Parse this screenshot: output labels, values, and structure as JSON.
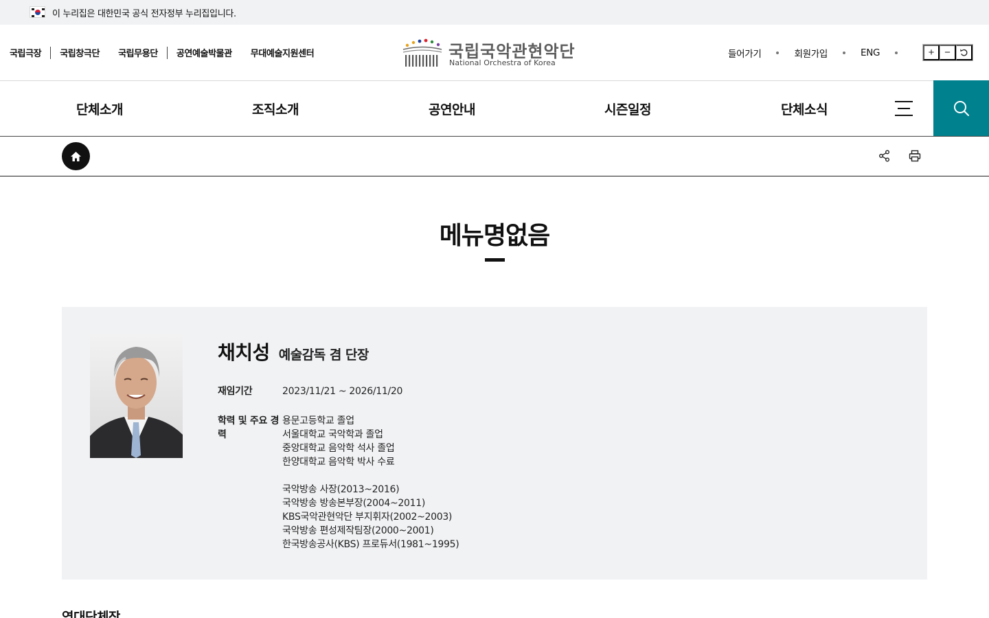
{
  "gov_banner": {
    "text": "이 누리집은 대한민국 공식 전자정부 누리집입니다."
  },
  "header": {
    "family_links": [
      "국립극장",
      "국립창극단",
      "국립무용단",
      "공연예술박물관",
      "무대예술지원센터"
    ],
    "logo": {
      "korean": "국립국악관현악단",
      "english": "National Orchestra of Korea"
    },
    "util_links": [
      "들어가기",
      "회원가입",
      "ENG"
    ],
    "zoom": {
      "in": "+",
      "out": "−",
      "reset": "↺"
    }
  },
  "gnb": {
    "items": [
      "단체소개",
      "조직소개",
      "공연안내",
      "시즌일정",
      "단체소식"
    ],
    "menu_icon": "hamburger-icon",
    "search_icon": "search-icon",
    "accent_color": "#00818e"
  },
  "location_bar": {
    "home_icon": "home-icon",
    "share_icon": "share-icon",
    "print_icon": "print-icon"
  },
  "page": {
    "title": "메뉴명없음"
  },
  "profile": {
    "name": "채치성",
    "position": "예술감독 겸 단장",
    "term_label": "재임기간",
    "term_value": "2023/11/21 ~ 2026/11/20",
    "career_label_line1": "학력 및 주요 경",
    "career_label_line2": "력",
    "career": [
      "용문고등학교 졸업",
      "서울대학교 국악학과 졸업",
      "중앙대학교 음악학 석사 졸업",
      "한양대학교 음악학 박사 수료",
      "",
      "국악방송 사장(2013~2016)",
      "국악방송 방송본부장(2004~2011)",
      "KBS국악관현악단 부지휘자(2002~2003)",
      "국악방송 편성제작팀장(2000~2001)",
      "한국방송공사(KBS) 프로듀서(1981~1995)"
    ]
  },
  "history": {
    "heading": "역대단체장"
  }
}
